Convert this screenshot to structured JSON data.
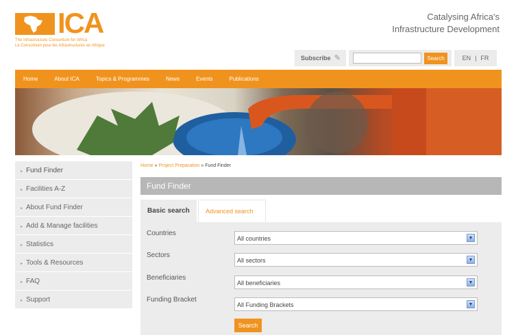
{
  "header": {
    "logo_letters": "ICA",
    "logo_line_en": "The Infrastructure Consortium for Africa",
    "logo_line_fr": "Le Consortium pour les Infrastructures en Afrique",
    "tagline_1": "Catalysing Africa's",
    "tagline_2": "Infrastructure Development",
    "subscribe_label": "Subscribe",
    "search_value": "",
    "search_button": "Search",
    "lang_en": "EN",
    "lang_sep": "|",
    "lang_fr": "FR"
  },
  "nav": [
    "Home",
    "About ICA",
    "Topics & Programmes",
    "News",
    "Events",
    "Publications"
  ],
  "sidebar": [
    "Fund Finder",
    "Facilities A-Z",
    "About Fund Finder",
    "Add & Manage facilities",
    "Statistics",
    "Tools & Resources",
    "FAQ",
    "Support"
  ],
  "breadcrumb": {
    "home": "Home",
    "sep": " » ",
    "project": "Project Preparation",
    "current": "Fund Finder"
  },
  "panel_title": "Fund Finder",
  "tabs": {
    "basic": "Basic search",
    "advanced": "Advanced search"
  },
  "form": {
    "countries_label": "Countries",
    "countries_value": "All countries",
    "sectors_label": "Sectors",
    "sectors_value": "All sectors",
    "beneficiaries_label": "Beneficiaries",
    "beneficiaries_value": "All beneficiaries",
    "funding_label": "Funding Bracket",
    "funding_value": "All Funding Brackets",
    "search_button": "Search"
  },
  "colors": {
    "brand_orange": "#f0931e",
    "panel_grey": "#b7b7b7",
    "light_grey": "#ececec"
  }
}
